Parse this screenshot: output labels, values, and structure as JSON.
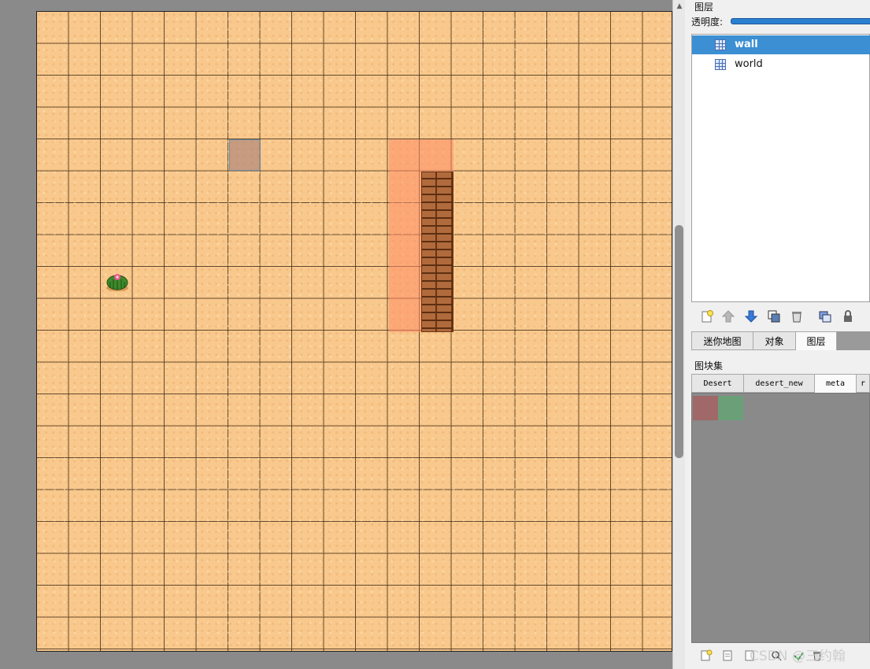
{
  "layers_panel": {
    "title": "图层",
    "opacity_label": "透明度:",
    "opacity_percent": 100,
    "layers": [
      {
        "name": "wall",
        "selected": true
      },
      {
        "name": "world",
        "selected": false
      }
    ],
    "toolbar_icons": [
      "new-layer-icon",
      "move-up-icon",
      "move-down-icon",
      "duplicate-icon",
      "delete-icon",
      "toggle-others-icon",
      "lock-icon"
    ]
  },
  "panel_tabs": {
    "items": [
      "迷你地图",
      "对象",
      "图层"
    ],
    "active": "图层"
  },
  "tilesets_panel": {
    "title": "图块集",
    "tabs": [
      "Desert",
      "desert_new",
      "meta",
      "r"
    ],
    "active": "meta",
    "meta_tile_colors": [
      "#a06868",
      "#6a9f78"
    ]
  },
  "bottom_toolbar": {
    "icons": [
      "new-tileset-icon",
      "import-icon",
      "export-icon",
      "search-icon",
      "add-icon",
      "delete-icon"
    ],
    "watermark": "CSDN @三约翰"
  },
  "map": {
    "tile_colors": {
      "sand": "#f9c88c",
      "meta_red": "#ff8c64",
      "brick": "#b06a3c",
      "selection": "#aa8278"
    }
  }
}
